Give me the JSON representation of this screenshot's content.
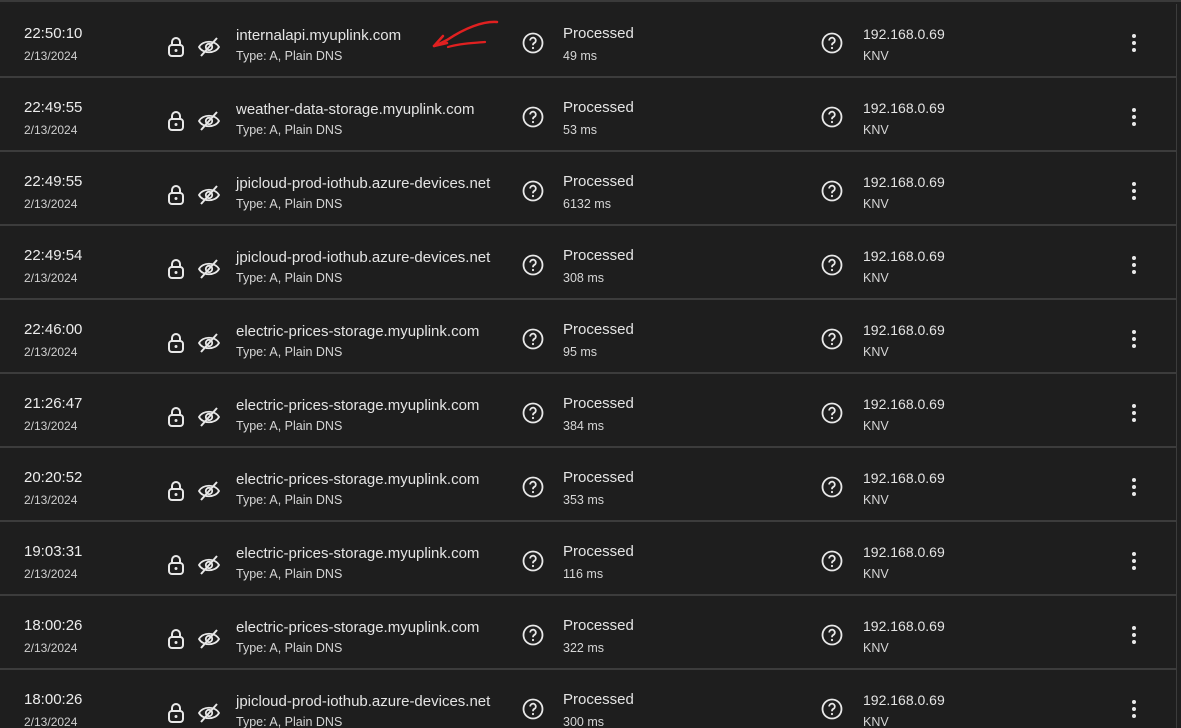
{
  "rows": [
    {
      "time": "22:50:10",
      "date": "2/13/2024",
      "domain": "internalapi.myuplink.com",
      "type": "Type: A, Plain DNS",
      "status": "Processed",
      "elapsed": "49 ms",
      "ip": "192.168.0.69",
      "client": "KNV"
    },
    {
      "time": "22:49:55",
      "date": "2/13/2024",
      "domain": "weather-data-storage.myuplink.com",
      "type": "Type: A, Plain DNS",
      "status": "Processed",
      "elapsed": "53 ms",
      "ip": "192.168.0.69",
      "client": "KNV"
    },
    {
      "time": "22:49:55",
      "date": "2/13/2024",
      "domain": "jpicloud-prod-iothub.azure-devices.net",
      "type": "Type: A, Plain DNS",
      "status": "Processed",
      "elapsed": "6132 ms",
      "ip": "192.168.0.69",
      "client": "KNV"
    },
    {
      "time": "22:49:54",
      "date": "2/13/2024",
      "domain": "jpicloud-prod-iothub.azure-devices.net",
      "type": "Type: A, Plain DNS",
      "status": "Processed",
      "elapsed": "308 ms",
      "ip": "192.168.0.69",
      "client": "KNV"
    },
    {
      "time": "22:46:00",
      "date": "2/13/2024",
      "domain": "electric-prices-storage.myuplink.com",
      "type": "Type: A, Plain DNS",
      "status": "Processed",
      "elapsed": "95 ms",
      "ip": "192.168.0.69",
      "client": "KNV"
    },
    {
      "time": "21:26:47",
      "date": "2/13/2024",
      "domain": "electric-prices-storage.myuplink.com",
      "type": "Type: A, Plain DNS",
      "status": "Processed",
      "elapsed": "384 ms",
      "ip": "192.168.0.69",
      "client": "KNV"
    },
    {
      "time": "20:20:52",
      "date": "2/13/2024",
      "domain": "electric-prices-storage.myuplink.com",
      "type": "Type: A, Plain DNS",
      "status": "Processed",
      "elapsed": "353 ms",
      "ip": "192.168.0.69",
      "client": "KNV"
    },
    {
      "time": "19:03:31",
      "date": "2/13/2024",
      "domain": "electric-prices-storage.myuplink.com",
      "type": "Type: A, Plain DNS",
      "status": "Processed",
      "elapsed": "116 ms",
      "ip": "192.168.0.69",
      "client": "KNV"
    },
    {
      "time": "18:00:26",
      "date": "2/13/2024",
      "domain": "electric-prices-storage.myuplink.com",
      "type": "Type: A, Plain DNS",
      "status": "Processed",
      "elapsed": "322 ms",
      "ip": "192.168.0.69",
      "client": "KNV"
    },
    {
      "time": "18:00:26",
      "date": "2/13/2024",
      "domain": "jpicloud-prod-iothub.azure-devices.net",
      "type": "Type: A, Plain DNS",
      "status": "Processed",
      "elapsed": "300 ms",
      "ip": "192.168.0.69",
      "client": "KNV"
    }
  ],
  "icons": {
    "lock": "lock-icon",
    "privacy": "eye-off-icon",
    "help": "question-circle-icon",
    "more": "more-vertical-icon",
    "annotation": "red-arrow-annotation"
  },
  "colors": {
    "background": "#1e1e1e",
    "divider": "#3c3c3c",
    "text": "#e4e4e4",
    "annotation": "#e02020"
  }
}
